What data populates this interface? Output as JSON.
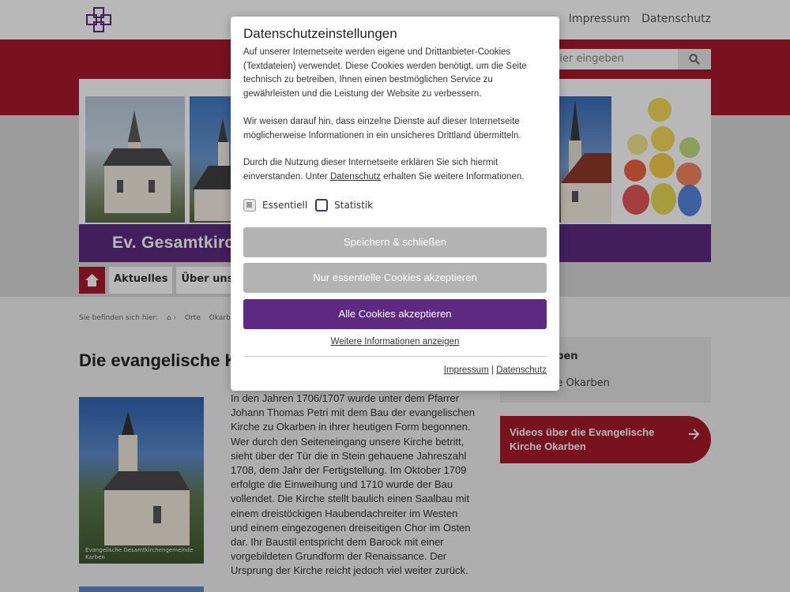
{
  "header": {
    "links": [
      "Impressum",
      "Datenschutz"
    ],
    "search_placeholder": "hier eingeben"
  },
  "banner": {
    "site_title": "Ev. Gesamtkirc"
  },
  "nav": {
    "items": [
      "Aktuelles",
      "Über uns"
    ]
  },
  "breadcrumb": {
    "prefix": "Sie befinden sich hier:",
    "items": [
      "Orte",
      "Okarben"
    ]
  },
  "content": {
    "title": "Die evangelische K",
    "photo_caption": "Evangelische Gesamtkirchengemeinde Karben",
    "body": "In den Jahren 1706/1707 wurde unter dem Pfarrer Johann Thomas Petri mit dem Bau der evangelischen Kirche zu Okarben in ihrer heutigen Form begonnen. Wer durch den Seiteneingang unsere Kirche betritt, sieht über der Tür die in Stein gehauene Jahreszahl 1708, dem Jahr der Fertigstellung. Im Oktober 1709 erfolgte die Einweihung und 1710 wurde der Bau vollendet. Die Kirche stellt baulich einen Saalbau mit einem dreistöckigen Haubendachreiter im Westen und einem eingezogenen dreiseitigen Chor im Osten dar. Ihr Baustil entspricht dem Barock mit einer vorgebildeten Grundform der Renaissance. Der Ursprung der Kirche reicht jedoch viel weiter zurück."
  },
  "sidebar": {
    "heading": "arben",
    "link": "che Okarben",
    "video_button": "Videos über die Evangelische Kirche Okarben"
  },
  "cookie_modal": {
    "title": "Datenschutzeinstellungen",
    "para1": "Auf unserer Internetseite werden eigene und Drittanbieter-Cookies (Textdateien) verwendet. Diese Cookies werden benötigt, um die Seite technisch zu betreiben, Ihnen einen bestmöglichen Service zu gewährleisten und die Leistung der Website zu verbessern.",
    "para2": "Wir weisen darauf hin, dass einzelne Dienste auf dieser Internetseite möglicherweise Informationen in ein unsicheres Drittland übermitteln.",
    "para3_before": "Durch die Nutzung dieser Internetseite erklären Sie sich hiermit einverstanden. Unter ",
    "para3_link": "Datenschutz",
    "para3_after": " erhalten Sie weitere Informationen.",
    "checkbox_essential": "Essentiell",
    "checkbox_stats": "Statistik",
    "btn_save": "Speichern & schließen",
    "btn_essential": "Nur essentielle Cookies akzeptieren",
    "btn_all": "Alle Cookies akzeptieren",
    "more_info": "Weitere Informationen anzeigen",
    "footer_impressum": "Impressum",
    "footer_separator": "|",
    "footer_datenschutz": "Datenschutz"
  },
  "colors": {
    "brand_red": "#a5192a",
    "brand_purple": "#5e2a81",
    "button_grey": "#b3b3b3"
  }
}
